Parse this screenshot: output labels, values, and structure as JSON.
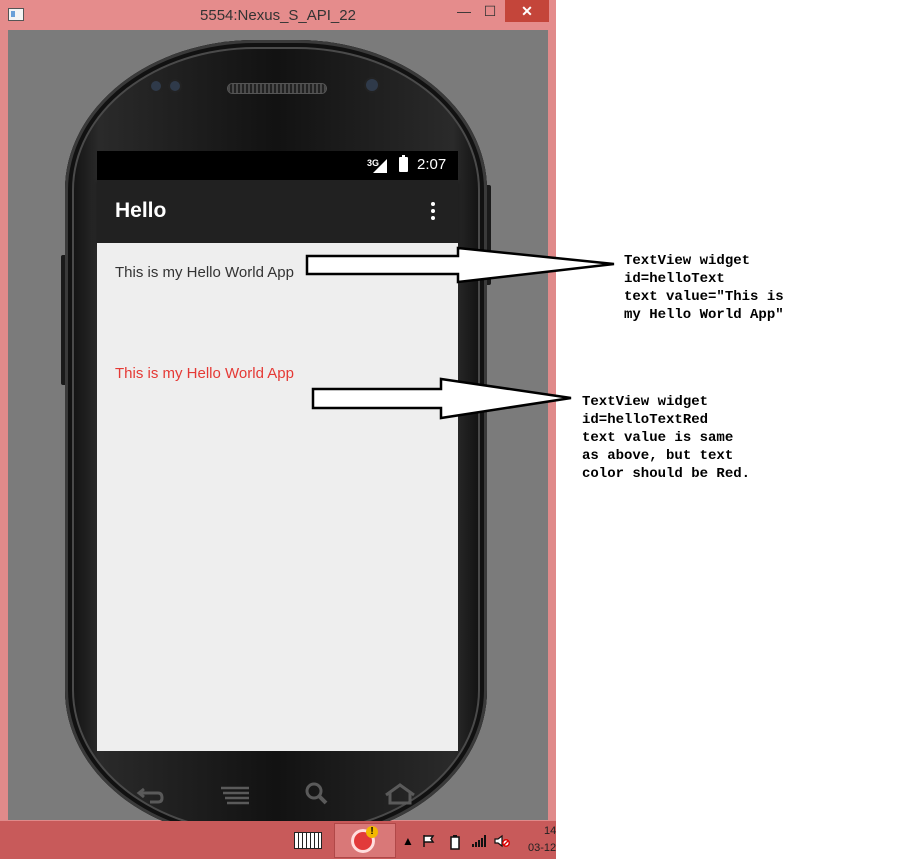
{
  "window": {
    "title": "5554:Nexus_S_API_22",
    "minimize_label": "—",
    "maximize_label": "☐",
    "close_label": "✕"
  },
  "status_bar": {
    "network": "3G",
    "time": "2:07"
  },
  "app_bar": {
    "title": "Hello"
  },
  "content": {
    "hello_text": "This is my Hello World App",
    "hello_text_red": "This is my Hello World App",
    "hello_text_red_color": "#e53935"
  },
  "taskbar": {
    "tray_up": "▲",
    "clock_line1": "14",
    "clock_line2": "03-12"
  },
  "annotations": {
    "note1": "TextView widget\nid=helloText\ntext value=\"This is\nmy Hello World App\"",
    "note2": "TextView widget\nid=helloTextRed\ntext value is same\nas above, but text\ncolor should be Red."
  },
  "colors": {
    "window_frame": "#e08a8a",
    "app_bar": "#212121",
    "content_bg": "#eeeeee",
    "taskbar": "#c85a5a"
  }
}
